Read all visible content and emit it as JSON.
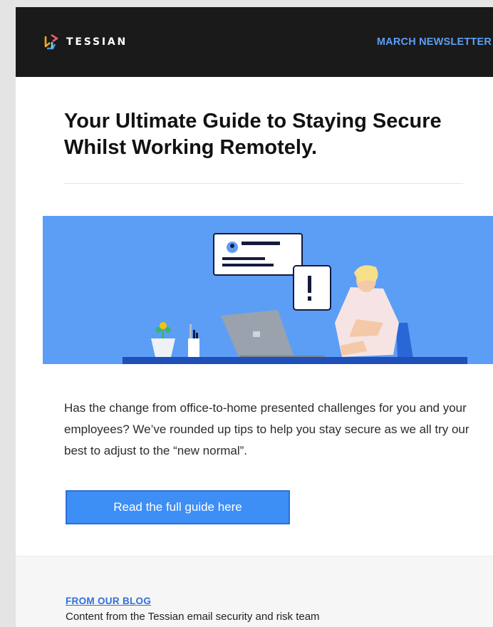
{
  "header": {
    "brand": "TESSIAN",
    "newsletter_label": "MARCH NEWSLETTER"
  },
  "main": {
    "headline": "Your Ultimate Guide to Staying Secure Whilst Working Remotely.",
    "intro": "Has the change from office-to-home presented challenges for you and your employees? We’ve rounded up tips to help you stay secure as we all try our best to adjust to the “new normal”.",
    "cta_label": "Read the full guide here"
  },
  "blog": {
    "label": "FROM OUR BLOG",
    "subtitle": "Content from the Tessian email security and risk team"
  },
  "colors": {
    "header_bg": "#1a1a1a",
    "accent": "#3d8ef5",
    "hero_bg": "#5c9ef5"
  }
}
